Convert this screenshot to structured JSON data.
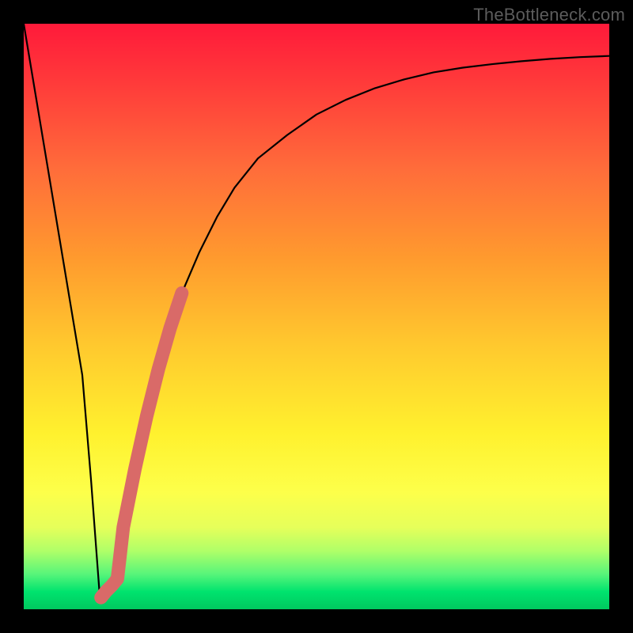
{
  "watermark": "TheBottleneck.com",
  "chart_data": {
    "type": "line",
    "title": "",
    "xlabel": "",
    "ylabel": "",
    "xlim": [
      0,
      100
    ],
    "ylim": [
      0,
      100
    ],
    "series": [
      {
        "name": "bottleneck-curve",
        "x": [
          0,
          2,
          4,
          6,
          8,
          10,
          11.5,
          13,
          15,
          17,
          19,
          21,
          23,
          25,
          27,
          30,
          33,
          36,
          40,
          45,
          50,
          55,
          60,
          65,
          70,
          75,
          80,
          85,
          90,
          95,
          100
        ],
        "y": [
          100,
          88,
          76,
          64,
          52,
          40,
          22,
          2,
          4,
          14,
          24,
          33,
          41,
          48,
          54,
          61,
          67,
          72,
          77,
          81,
          84.5,
          87,
          89,
          90.5,
          91.7,
          92.5,
          93.1,
          93.6,
          94,
          94.3,
          94.5
        ]
      },
      {
        "name": "highlight-segment",
        "x": [
          13.2,
          14.0,
          15.0,
          16.0,
          17.0,
          18.0,
          19.0,
          20.0,
          21.0,
          22.0,
          23.0,
          24.0,
          25.0,
          26.0,
          27.0
        ],
        "y": [
          2.0,
          3.0,
          4.0,
          5.2,
          14.0,
          19.0,
          24.0,
          28.5,
          33.0,
          37.0,
          41.0,
          44.5,
          48.0,
          51.0,
          54.0
        ]
      }
    ],
    "gradient_stops": [
      {
        "pos": 0,
        "color": "#ff1a3a"
      },
      {
        "pos": 25,
        "color": "#ff6d3a"
      },
      {
        "pos": 55,
        "color": "#ffc92e"
      },
      {
        "pos": 80,
        "color": "#fdff4a"
      },
      {
        "pos": 97,
        "color": "#00e36e"
      },
      {
        "pos": 100,
        "color": "#00c95f"
      }
    ],
    "colors": {
      "curve": "#000000",
      "highlight": "#d96a68",
      "background_frame": "#000000"
    }
  }
}
